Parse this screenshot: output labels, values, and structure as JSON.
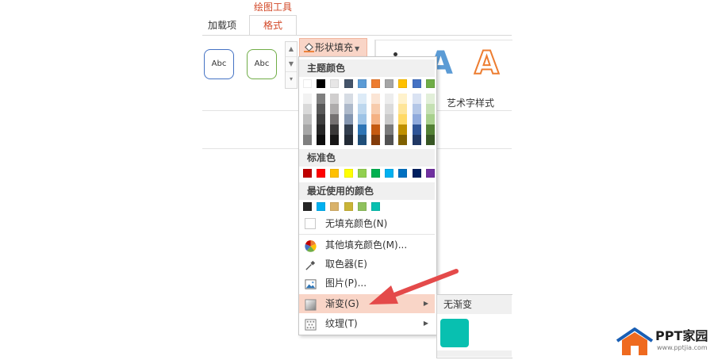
{
  "ribbon": {
    "tools_title": "绘图工具",
    "tabs": [
      {
        "label": "加载项"
      },
      {
        "label": "格式"
      }
    ],
    "shape_styles": [
      {
        "label": "Abc",
        "border": "#4472c4"
      },
      {
        "label": "Abc",
        "border": "#70ad47"
      }
    ],
    "fill_button": {
      "icon": "paint-bucket-icon",
      "label": "形状填充"
    },
    "wordart": {
      "label": "艺术字样式",
      "letters": [
        "A",
        "A"
      ]
    }
  },
  "menu": {
    "theme_header": "主题颜色",
    "theme_colors": [
      "#ffffff",
      "#000000",
      "#e7e6e6",
      "#44546a",
      "#5b9bd5",
      "#ed7d31",
      "#a5a5a5",
      "#ffc000",
      "#4472c4",
      "#70ad47"
    ],
    "theme_shades": [
      [
        "#f2f2f2",
        "#d9d9d9",
        "#bfbfbf",
        "#a6a6a6",
        "#7f7f7f"
      ],
      [
        "#7f7f7f",
        "#595959",
        "#3f3f3f",
        "#262626",
        "#0d0d0d"
      ],
      [
        "#d0cece",
        "#aeabab",
        "#757171",
        "#3a3838",
        "#171616"
      ],
      [
        "#d6dce4",
        "#adb9ca",
        "#8496b0",
        "#333f4f",
        "#222a35"
      ],
      [
        "#ddebf7",
        "#bdd7ee",
        "#9dc3e6",
        "#2e75b5",
        "#1f4e79"
      ],
      [
        "#fbe5d5",
        "#f7cbac",
        "#f4b183",
        "#c55a11",
        "#833c0b"
      ],
      [
        "#ededed",
        "#dbdbdb",
        "#c9c9c9",
        "#7b7b7b",
        "#525252"
      ],
      [
        "#fff2cc",
        "#fee599",
        "#ffd965",
        "#bf9000",
        "#7f6000"
      ],
      [
        "#dae3f3",
        "#b4c7e7",
        "#8faadc",
        "#2f5597",
        "#203864"
      ],
      [
        "#e2efd9",
        "#c5e0b3",
        "#a8d08d",
        "#538135",
        "#375623"
      ]
    ],
    "standard_header": "标准色",
    "standard_colors": [
      "#c00000",
      "#ff0000",
      "#ffc000",
      "#ffff00",
      "#92d050",
      "#00b050",
      "#00b0f0",
      "#0070c0",
      "#002060",
      "#7030a0"
    ],
    "recent_header": "最近使用的颜色",
    "recent_colors": [
      "#262626",
      "#00b0f0",
      "#d9b26a",
      "#c9b437",
      "#8fc15d",
      "#08c0b0"
    ],
    "items": [
      {
        "label": "无填充颜色(N)",
        "icon": "no-fill-icon"
      },
      {
        "label": "其他填充颜色(M)...",
        "icon": "color-wheel-icon"
      },
      {
        "label": "取色器(E)",
        "icon": "eyedropper-icon"
      },
      {
        "label": "图片(P)...",
        "icon": "picture-icon"
      },
      {
        "label": "渐变(G)",
        "icon": "gradient-icon"
      },
      {
        "label": "纹理(T)",
        "icon": "texture-icon"
      }
    ]
  },
  "submenu": {
    "header": "无渐变",
    "swatch_color": "#08c0b0"
  },
  "annotation": {
    "color": "#e44a4a"
  },
  "logo": {
    "text": "PPT家园",
    "url": "www.pptjia.com",
    "house_color": "#ef6a1f",
    "roof_color": "#1a5fb4"
  }
}
